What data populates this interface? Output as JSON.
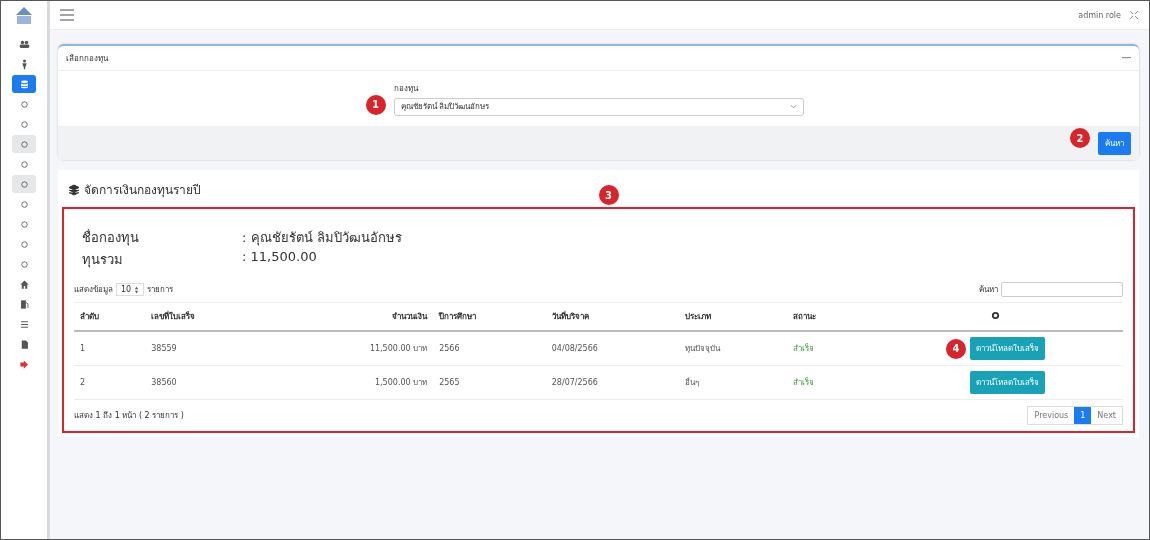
{
  "sidebar": {
    "items": [
      {
        "kind": "users",
        "selected": false,
        "open": false
      },
      {
        "kind": "person",
        "selected": false,
        "open": false
      },
      {
        "kind": "database",
        "selected": true,
        "open": false
      },
      {
        "kind": "circle",
        "selected": false,
        "open": false
      },
      {
        "kind": "circle",
        "selected": false,
        "open": false
      },
      {
        "kind": "circle",
        "selected": false,
        "open": true
      },
      {
        "kind": "circle",
        "selected": false,
        "open": false
      },
      {
        "kind": "circle",
        "selected": false,
        "open": true
      },
      {
        "kind": "circle",
        "selected": false,
        "open": false
      },
      {
        "kind": "circle",
        "selected": false,
        "open": false
      },
      {
        "kind": "circle",
        "selected": false,
        "open": false
      },
      {
        "kind": "circle",
        "selected": false,
        "open": false
      },
      {
        "kind": "home",
        "selected": false,
        "open": false
      },
      {
        "kind": "pump",
        "selected": false,
        "open": false
      },
      {
        "kind": "list",
        "selected": false,
        "open": false
      },
      {
        "kind": "file",
        "selected": false,
        "open": false
      },
      {
        "kind": "logout",
        "selected": false,
        "open": false
      }
    ]
  },
  "header": {
    "user": "admin role"
  },
  "filter_card": {
    "title": "เลือกกองทุน",
    "field_label": "กองทุน",
    "select_value": "คุณชัยรัตน์ ลิมปิวัฒนอักษร",
    "button": "ค้นหา"
  },
  "section": {
    "title": "จัดการเงินกองทุนรายปี",
    "info": [
      {
        "label": "ชื่อกองทุน",
        "value": ": คุณชัยรัตน์ ลิมปิวัฒนอักษร"
      },
      {
        "label": "ทุนรวม",
        "value": ": 11,500.00"
      }
    ],
    "length_prefix": "แสดงข้อมูล",
    "length_value": "10",
    "length_suffix": "รายการ",
    "search_label": "ค้นหา",
    "columns": [
      "ลำดับ",
      "เลขที่ใบเสร็จ",
      "จำนวนเงิน",
      "ปีการศึกษา",
      "วันที่บริจาค",
      "ประเภท",
      "สถานะ"
    ],
    "rows": [
      {
        "no": "1",
        "receipt": "38559",
        "amount": "11,500.00 บาท",
        "year": "2566",
        "date": "04/08/2566",
        "type": "ทุนปัจจุบัน",
        "status": "สำเร็จ",
        "action": "ดาวน์โหลดใบเสร็จ"
      },
      {
        "no": "2",
        "receipt": "38560",
        "amount": "1,500.00 บาท",
        "year": "2565",
        "date": "28/07/2566",
        "type": "อื่นๆ",
        "status": "สำเร็จ",
        "action": "ดาวน์โหลดใบเสร็จ"
      }
    ],
    "info_text": "แสดง 1 ถึง 1 หน้า ( 2 รายการ )",
    "pagination": [
      {
        "label": "Previous",
        "selected": false
      },
      {
        "label": "1",
        "selected": true
      },
      {
        "label": "Next",
        "selected": false
      }
    ]
  },
  "callouts": [
    "1",
    "2",
    "3",
    "4"
  ]
}
